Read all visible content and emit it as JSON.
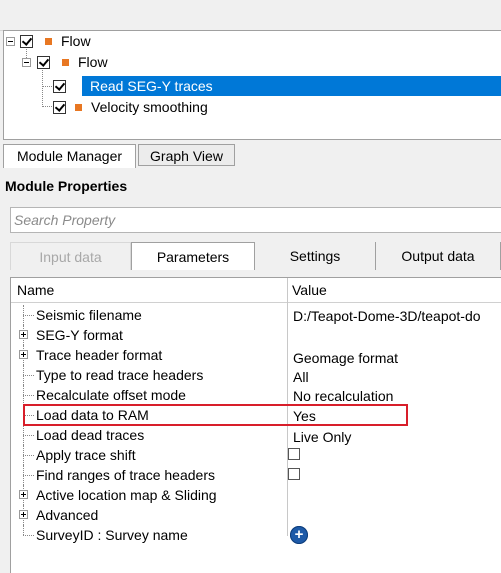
{
  "tree": {
    "items": [
      {
        "label": "Flow",
        "checked": true,
        "icon": "flow-square-icon"
      },
      {
        "label": "Flow",
        "checked": true,
        "icon": "flow-square-icon"
      },
      {
        "label": "Read SEG-Y traces",
        "checked": true,
        "icon": "checkmark-icon",
        "selected": true
      },
      {
        "label": "Velocity smoothing",
        "checked": true,
        "icon": "flow-square-icon"
      }
    ]
  },
  "bottom_tabs": {
    "module_manager": "Module Manager",
    "graph_view": "Graph View"
  },
  "module_properties": {
    "title": "Module Properties"
  },
  "search": {
    "placeholder": "Search Property"
  },
  "property_tabs": {
    "input": "Input data",
    "parameters": "Parameters",
    "settings": "Settings",
    "output": "Output data"
  },
  "grid": {
    "headers": {
      "name": "Name",
      "value": "Value"
    },
    "rows": [
      {
        "name": "Seismic filename",
        "value": "D:/Teapot-Dome-3D/teapot-do"
      },
      {
        "name": "SEG-Y format",
        "value": ""
      },
      {
        "name": "Trace header format",
        "value": "Geomage format"
      },
      {
        "name": "Type to read trace headers",
        "value": "All"
      },
      {
        "name": "Recalculate offset mode",
        "value": "No recalculation"
      },
      {
        "name": "Load data to RAM",
        "value": "Yes"
      },
      {
        "name": "Load dead traces",
        "value": "Live Only"
      },
      {
        "name": "Apply trace shift",
        "value": ""
      },
      {
        "name": "Find ranges of trace headers",
        "value": ""
      },
      {
        "name": "Active location map & Sliding",
        "value": ""
      },
      {
        "name": "Advanced",
        "value": ""
      },
      {
        "name": "SurveyID : Survey name",
        "value": ""
      }
    ],
    "add_button_symbol": "+"
  },
  "colors": {
    "selection": "#0078d7",
    "flow_icon": "#e87722",
    "highlight": "#d81e2a",
    "add_button": "#1d5aa8"
  }
}
